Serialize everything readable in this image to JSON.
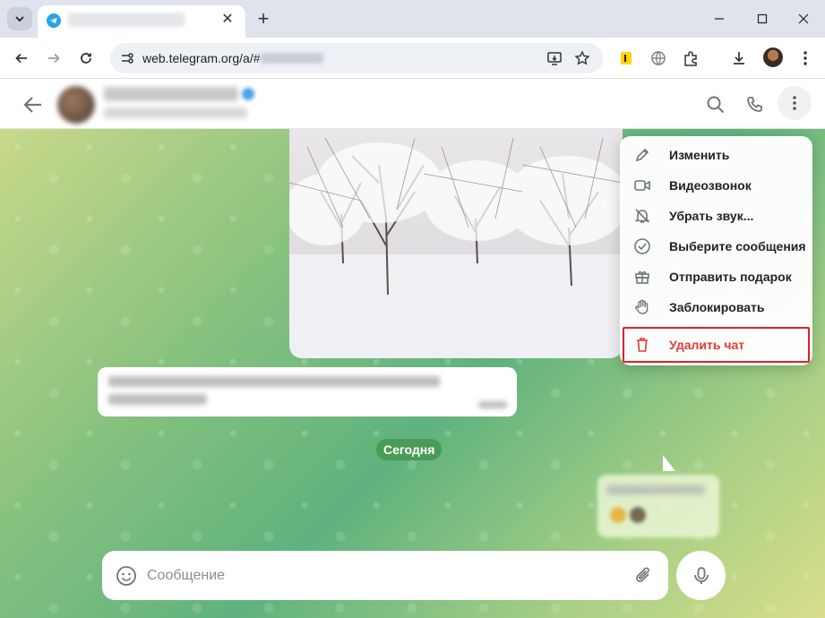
{
  "browser": {
    "url": "web.telegram.org/a/#",
    "tab_close": "✕",
    "new_tab": "+"
  },
  "chat": {
    "date_label": "Сегодня",
    "composer_placeholder": "Сообщение"
  },
  "menu": {
    "items": [
      {
        "label": "Изменить",
        "icon": "pencil-icon"
      },
      {
        "label": "Видеозвонок",
        "icon": "video-camera-icon"
      },
      {
        "label": "Убрать звук...",
        "icon": "bell-off-icon"
      },
      {
        "label": "Выберите сообщения",
        "icon": "check-circle-icon"
      },
      {
        "label": "Отправить подарок",
        "icon": "gift-icon"
      },
      {
        "label": "Заблокировать",
        "icon": "hand-icon"
      },
      {
        "label": "Удалить чат",
        "icon": "trash-icon",
        "danger": true
      }
    ]
  },
  "colors": {
    "accent_danger": "#e53935",
    "date_pill": "#4a9b57",
    "highlight_border": "#e0202a"
  }
}
